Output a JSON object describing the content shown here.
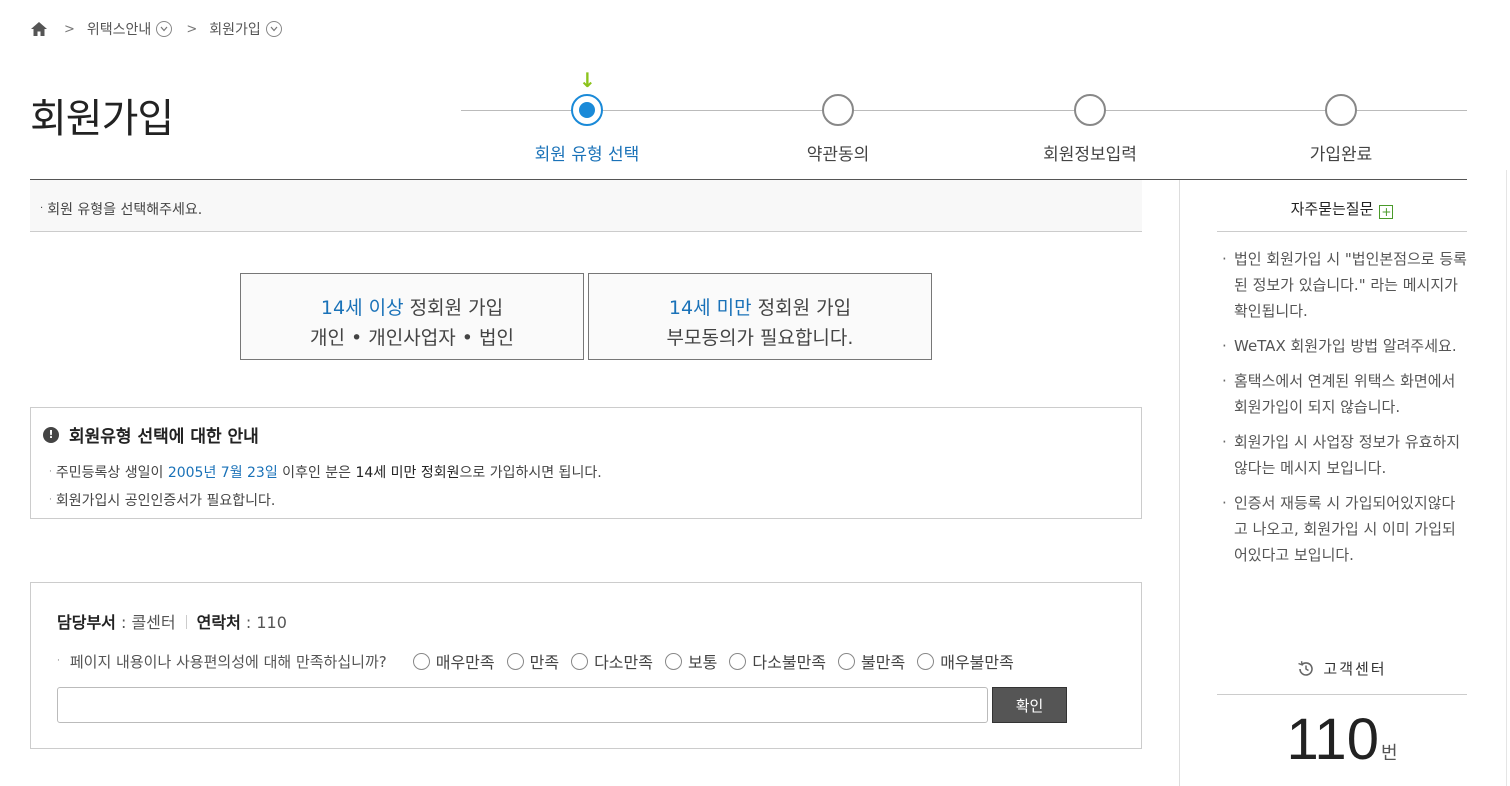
{
  "breadcrumb": {
    "items": [
      "위택스안내",
      "회원가입"
    ]
  },
  "page": {
    "title": "회원가입"
  },
  "steps": [
    {
      "label": "회원 유형 선택",
      "active": true
    },
    {
      "label": "약관동의",
      "active": false
    },
    {
      "label": "회원정보입력",
      "active": false
    },
    {
      "label": "가입완료",
      "active": false
    }
  ],
  "notice": "회원 유형을 선택해주세요.",
  "member_types": [
    {
      "highlight": "14세 이상",
      "title_rest": " 정회원 가입",
      "desc": "개인 • 개인사업자 • 법인"
    },
    {
      "highlight": "14세 미만",
      "title_rest": " 정회원 가입",
      "desc": "부모동의가 필요합니다."
    }
  ],
  "guide": {
    "title": "회원유형 선택에 대한 안내",
    "line1_a": "주민등록상 생일이 ",
    "line1_date": "2005년 7월 23일",
    "line1_b": " 이후인 분은 ",
    "line1_strong": "14세 미만 정회원",
    "line1_c": "으로 가입하시면 됩니다.",
    "line2": "회원가입시 공인인증서가 필요합니다."
  },
  "survey": {
    "dept_label": "담당부서",
    "dept_value": " : 콜센터",
    "contact_label": "연락처",
    "contact_value": " : 110",
    "question": "페이지 내용이나 사용편의성에 대해 만족하십니까?",
    "options": [
      "매우만족",
      "만족",
      "다소만족",
      "보통",
      "다소불만족",
      "불만족",
      "매우불만족"
    ],
    "confirm_label": "확인"
  },
  "faq": {
    "title": "자주묻는질문",
    "items": [
      "법인 회원가입 시 \"법인본점으로 등록된 정보가 있습니다.\" 라는 메시지가 확인됩니다.",
      "WeTAX 회원가입 방법 알려주세요.",
      "홈택스에서 연계된 위택스 화면에서 회원가입이 되지 않습니다.",
      "회원가입 시 사업장 정보가 유효하지않다는 메시지 보입니다.",
      "인증서 재등록 시 가입되어있지않다고 나오고, 회원가입 시 이미 가입되어있다고 보입니다."
    ]
  },
  "customer_center": {
    "title": "고객센터",
    "number": "110",
    "unit": "번"
  },
  "colors": {
    "accent": "#1a72b8",
    "active_step": "#1a8ad8",
    "arrow": "#8cc31c"
  }
}
